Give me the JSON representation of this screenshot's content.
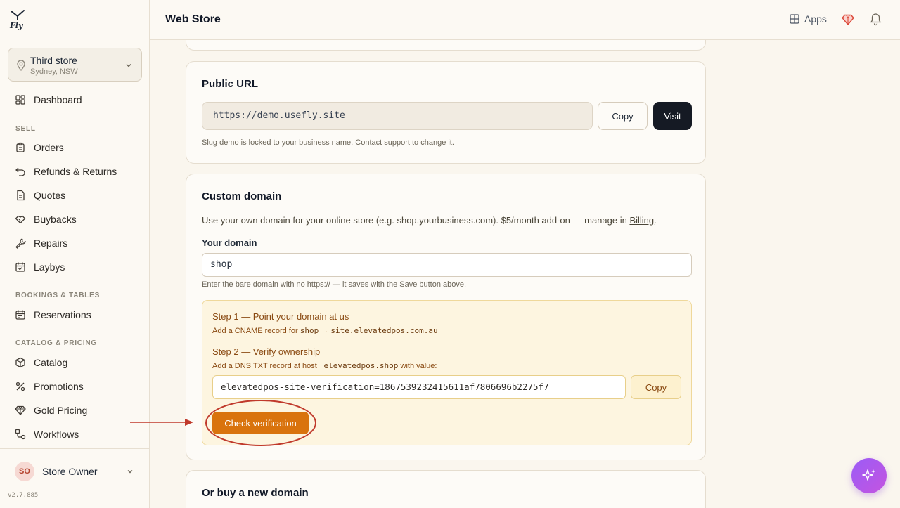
{
  "brand": {
    "logo_text": "Fly"
  },
  "store": {
    "name": "Third store",
    "location": "Sydney, NSW"
  },
  "nav": {
    "dashboard": "Dashboard",
    "sell_label": "SELL",
    "orders": "Orders",
    "refunds": "Refunds & Returns",
    "quotes": "Quotes",
    "buybacks": "Buybacks",
    "repairs": "Repairs",
    "laybys": "Laybys",
    "bookings_label": "BOOKINGS & TABLES",
    "reservations": "Reservations",
    "catalog_label": "CATALOG & PRICING",
    "catalog": "Catalog",
    "promotions": "Promotions",
    "gold_pricing": "Gold Pricing",
    "workflows": "Workflows"
  },
  "user": {
    "initials": "SO",
    "name": "Store Owner"
  },
  "version": "v2.7.885",
  "header": {
    "title": "Web Store",
    "apps_label": "Apps"
  },
  "public_url": {
    "title": "Public URL",
    "url": "https://demo.usefly.site",
    "copy_label": "Copy",
    "visit_label": "Visit",
    "hint": "Slug demo is locked to your business name. Contact support to change it."
  },
  "custom_domain": {
    "title": "Custom domain",
    "description": "Use your own domain for your online store (e.g. shop.yourbusiness.com). $5/month add-on — manage in ",
    "billing_link": "Billing",
    "description_end": ".",
    "field_label": "Your domain",
    "domain_value": "shop",
    "field_hint": "Enter the bare domain with no https:// — it saves with the Save button above.",
    "step1_title": "Step 1 — Point your domain at us",
    "step1_sub_prefix": "Add a CNAME record for ",
    "step1_host": "shop",
    "step1_arrow": " → ",
    "step1_target": "site.elevatedpos.com.au",
    "step2_title": "Step 2 — Verify ownership",
    "step2_sub_prefix": "Add a DNS TXT record at host ",
    "step2_host": "_elevatedpos.shop",
    "step2_sub_suffix": " with value:",
    "verification_value": "elevatedpos-site-verification=1867539232415611af7806696b2275f7",
    "copy_label": "Copy",
    "check_label": "Check verification"
  },
  "buy_domain": {
    "title": "Or buy a new domain"
  },
  "colors": {
    "accent_orange": "#d9730d",
    "dark_button": "#151a24",
    "annotation_red": "#c0392b",
    "fab_purple": "#a855f7"
  }
}
